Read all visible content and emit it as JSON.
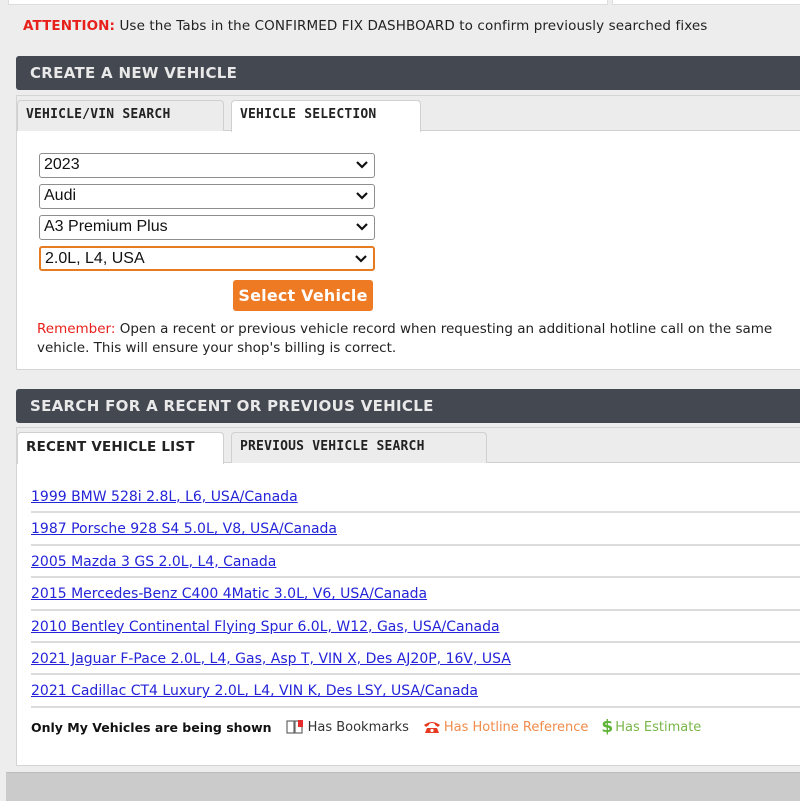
{
  "attention": {
    "label": "ATTENTION:",
    "text": " Use the Tabs in the CONFIRMED FIX DASHBOARD to confirm previously searched fixes"
  },
  "create_panel": {
    "title": "CREATE A NEW VEHICLE",
    "tabs": [
      {
        "label": "VEHICLE/VIN SEARCH",
        "active": false
      },
      {
        "label": "VEHICLE SELECTION",
        "active": true
      }
    ],
    "selects": {
      "year": "2023",
      "make": "Audi",
      "model": "A3 Premium Plus",
      "engine": "2.0L, L4, USA"
    },
    "select_button": "Select Vehicle",
    "remember_label": "Remember:",
    "remember_text": " Open a recent or previous vehicle record when requesting an additional hotline call on the same vehicle. This will ensure your shop's billing is correct."
  },
  "search_panel": {
    "title": "SEARCH FOR A RECENT OR PREVIOUS VEHICLE",
    "tabs": [
      {
        "label": "RECENT VEHICLE LIST",
        "active": true
      },
      {
        "label": "PREVIOUS VEHICLE SEARCH",
        "active": false
      }
    ],
    "vehicles": [
      "1999 BMW 528i 2.8L, L6, USA/Canada",
      "1987 Porsche 928 S4 5.0L, V8, USA/Canada",
      "2005 Mazda 3 GS 2.0L, L4, Canada",
      "2015 Mercedes-Benz C400 4Matic 3.0L, V6, USA/Canada",
      "2010 Bentley Continental Flying Spur 6.0L, W12, Gas, USA/Canada",
      "2021 Jaguar F-Pace 2.0L, L4, Gas, Asp T, VIN X, Des AJ20P, 16V, USA",
      "2021 Cadillac CT4 Luxury 2.0L, L4, VIN K, Des LSY, USA/Canada"
    ],
    "legend": {
      "only_mine": "Only My Vehicles are being shown",
      "bookmarks": "Has Bookmarks",
      "hotline": "Has Hotline Reference",
      "estimate": "Has Estimate"
    }
  },
  "colors": {
    "accent_orange": "#ee7a24",
    "attention_red": "#e8201b",
    "header_dark": "#444851",
    "link_blue": "#2424d8",
    "estimate_green": "#7ab648",
    "hotline_orange": "#f08b4a"
  }
}
